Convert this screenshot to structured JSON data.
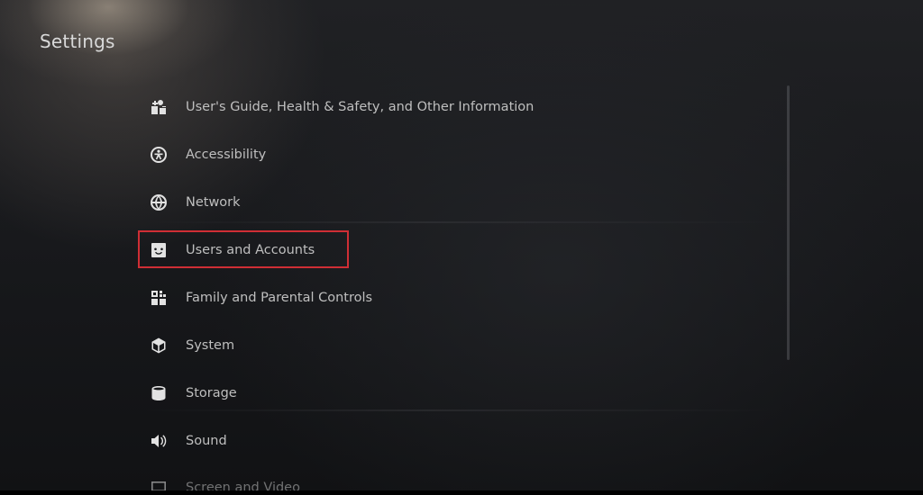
{
  "header": {
    "title": "Settings"
  },
  "menu": {
    "items": [
      {
        "label": "User's Guide, Health & Safety, and Other Information",
        "icon": "info-grid-icon"
      },
      {
        "label": "Accessibility",
        "icon": "accessibility-icon"
      },
      {
        "label": "Network",
        "icon": "globe-icon"
      },
      {
        "label": "Users and Accounts",
        "icon": "user-face-icon",
        "highlighted": true
      },
      {
        "label": "Family and Parental Controls",
        "icon": "family-icon"
      },
      {
        "label": "System",
        "icon": "cube-icon"
      },
      {
        "label": "Storage",
        "icon": "storage-icon"
      },
      {
        "label": "Sound",
        "icon": "speaker-icon"
      },
      {
        "label": "Screen and Video",
        "icon": "monitor-icon"
      }
    ]
  },
  "colors": {
    "highlight_border": "#cf2e35",
    "background": "#151618",
    "label_text": "#bfbfbf"
  }
}
